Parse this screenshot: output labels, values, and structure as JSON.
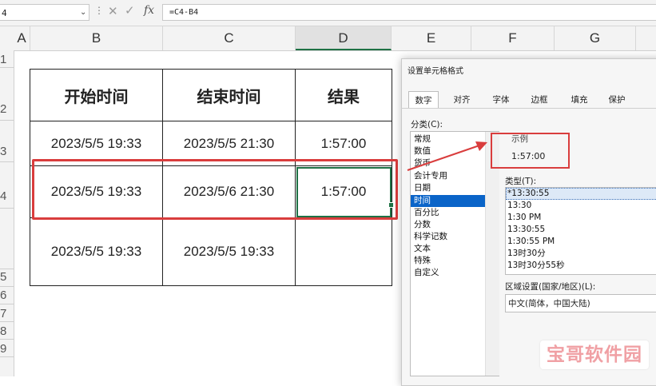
{
  "formula_bar": {
    "name_box": "4",
    "formula": "=C4-B4",
    "fx_label": "fx",
    "cancel_glyph": "✕",
    "enter_glyph": "✓",
    "dots": "⋮"
  },
  "column_headers": [
    "A",
    "B",
    "C",
    "D",
    "E",
    "F",
    "G"
  ],
  "row_headers": [
    "1",
    "2",
    "3",
    "4",
    "5",
    "6",
    "7",
    "8",
    "9"
  ],
  "table": {
    "headers": [
      "开始时间",
      "结束时间",
      "结果"
    ],
    "rows": [
      [
        "2023/5/5 19:33",
        "2023/5/5 21:30",
        "1:57:00"
      ],
      [
        "2023/5/5 19:33",
        "2023/5/6 21:30",
        "1:57:00"
      ],
      [
        "2023/5/5 19:33",
        "2023/5/5 19:33",
        ""
      ]
    ]
  },
  "dialog": {
    "title": "设置单元格格式",
    "tabs": [
      "数字",
      "对齐",
      "字体",
      "边框",
      "填充",
      "保护"
    ],
    "active_tab": "数字",
    "category_label": "分类(C):",
    "categories": [
      "常规",
      "数值",
      "货币",
      "会计专用",
      "日期",
      "时间",
      "百分比",
      "分数",
      "科学记数",
      "文本",
      "特殊",
      "自定义"
    ],
    "selected_category": "时间",
    "sample_label": "示例",
    "sample_value": "1:57:00",
    "type_label": "类型(T):",
    "types": [
      "*13:30:55",
      "13:30",
      "1:30 PM",
      "13:30:55",
      "1:30:55 PM",
      "13时30分",
      "13时30分55秒"
    ],
    "selected_type": "*13:30:55",
    "locale_label": "区域设置(国家/地区)(L):",
    "locale_value": "中文(简体，中国大陆)"
  },
  "watermark": "宝哥软件园",
  "colors": {
    "highlight_red": "#d93d3d",
    "excel_green": "#1e7145",
    "selection_blue": "#0a64c8"
  }
}
